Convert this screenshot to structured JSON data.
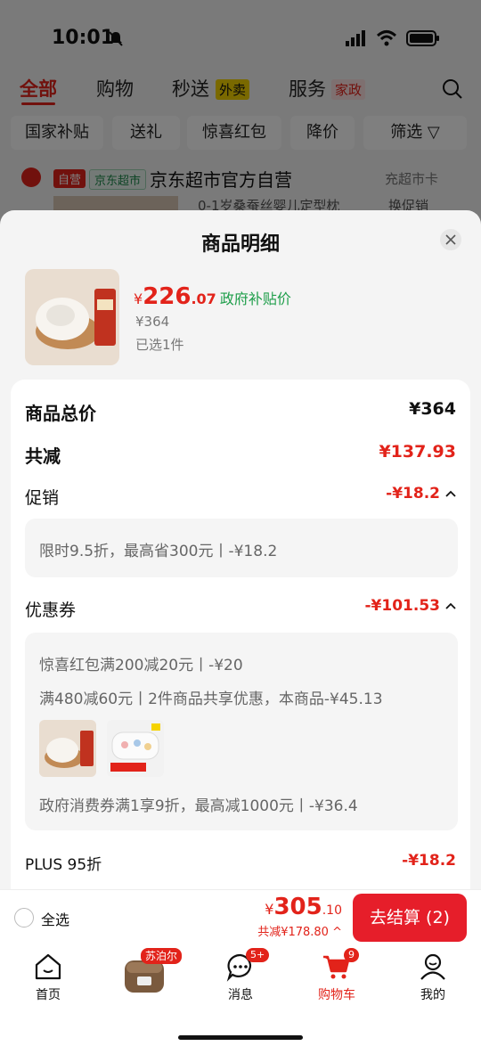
{
  "status_bar": {
    "time": "10:01"
  },
  "top_tabs": [
    {
      "label": "全部"
    },
    {
      "label": "购物"
    },
    {
      "label": "秒送",
      "badge": "外卖"
    },
    {
      "label": "服务",
      "badge": "家政"
    }
  ],
  "filters": [
    "国家补贴",
    "送礼",
    "惊喜红包",
    "降价",
    "筛选"
  ],
  "store": {
    "badge_self": "自营",
    "badge_market": "京东超市",
    "name": "京东超市官方自营",
    "link": "充超市卡"
  },
  "bg_item": {
    "title": "0-1岁桑蚕丝婴儿定型枕",
    "action": "换促销"
  },
  "sheet": {
    "title": "商品明细",
    "product": {
      "price_yen": "¥",
      "price_int": "226",
      "price_dec": ".07",
      "price_tag": "政府补贴价",
      "orig_price": "¥364",
      "selected": "已选1件"
    },
    "rows": {
      "total_label": "商品总价",
      "total_value": "¥364",
      "reduce_label": "共减",
      "reduce_value": "¥137.93",
      "promo_label": "促销",
      "promo_value": "-¥18.2",
      "promo_detail": "限时9.5折，最高省300元丨-¥18.2",
      "coupon_label": "优惠券",
      "coupon_value": "-¥101.53",
      "coupon_line1": "惊喜红包满200减20元丨-¥20",
      "coupon_line2": "满480减60元丨2件商品共享优惠，本商品-¥45.13",
      "coupon_line3": "政府消费券满1享9折，最高减1000元丨-¥36.4",
      "plus_label": "PLUS 95折",
      "plus_value": "-¥18.2"
    }
  },
  "checkout": {
    "select_all": "全选",
    "total_yen": "¥",
    "total_int": "305",
    "total_dec": ".10",
    "saving": "共减¥178.80",
    "button": "去结算 (2)"
  },
  "tab_bar": {
    "items": [
      {
        "label": "首页",
        "icon": "home-icon"
      },
      {
        "label": "",
        "icon": "rice-cooker-promo"
      },
      {
        "label": "消息",
        "icon": "message-icon",
        "count": "5+"
      },
      {
        "label": "购物车",
        "icon": "cart-icon",
        "count": "9"
      },
      {
        "label": "我的",
        "icon": "profile-icon"
      }
    ],
    "promo_brand": "苏泊尔"
  },
  "colors": {
    "accent": "#e2231a",
    "green": "#1e9e4a",
    "checkout": "#e61e2a"
  }
}
